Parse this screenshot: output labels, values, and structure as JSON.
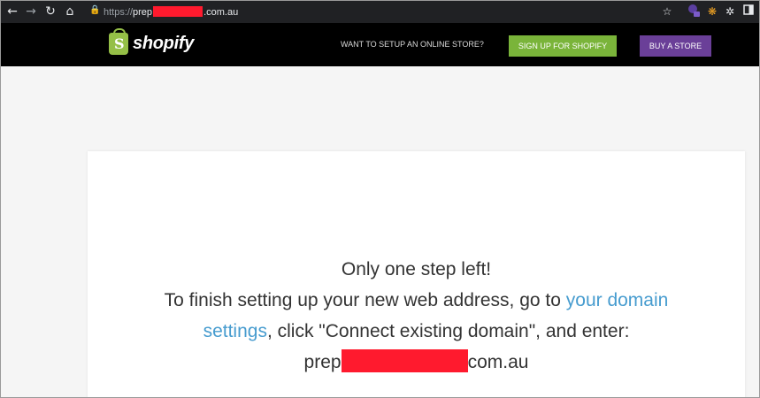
{
  "browser": {
    "url_scheme": "https://",
    "url_host_start": "prep",
    "url_host_end": ".com.au",
    "icons": [
      "back-icon",
      "forward-icon",
      "reload-icon",
      "home-icon",
      "lock-icon",
      "star-icon",
      "extension-icon",
      "puzzle-icon",
      "sidepanel-icon"
    ]
  },
  "header": {
    "logo_text": "shopify",
    "logo_letter": "S",
    "promo_text": "WANT TO SETUP AN ONLINE STORE?",
    "signup_label": "SIGN UP FOR SHOPIFY",
    "buy_label": "BUY A STORE"
  },
  "card": {
    "headline": "Only one step left!",
    "line1_prefix": "To finish setting up your new web address, go to ",
    "link_text_1": "your domain",
    "link_text_2": "settings",
    "line2_suffix": ", click \"Connect existing domain\", and enter:",
    "domain_start": "prep",
    "domain_end": "com.au"
  },
  "colors": {
    "brand_green": "#95bf47",
    "signup_green": "#7ab43a",
    "buy_purple": "#6a3f98",
    "link_blue": "#479ccf",
    "redaction": "#ff1a2e"
  }
}
